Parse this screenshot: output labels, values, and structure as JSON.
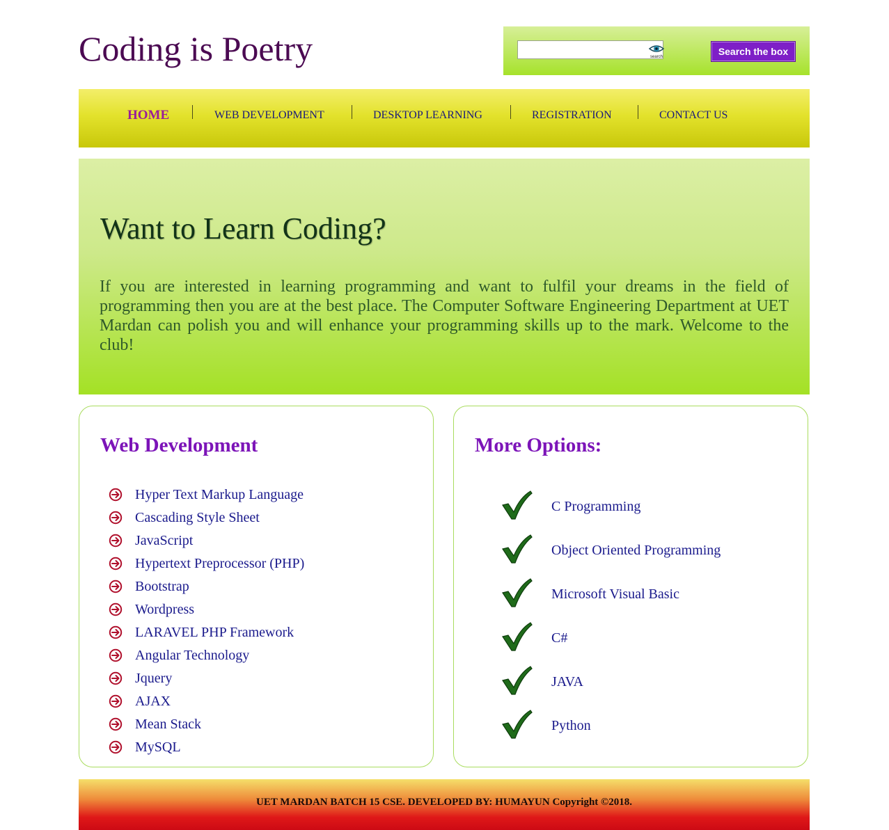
{
  "header": {
    "site_title": "Coding is Poetry",
    "search": {
      "placeholder": "",
      "icon_label": "search",
      "button_label": "Search the box"
    }
  },
  "nav": {
    "items": [
      {
        "label": "HOME",
        "active": true
      },
      {
        "label": "WEB DEVELOPMENT",
        "active": false
      },
      {
        "label": "DESKTOP LEARNING",
        "active": false
      },
      {
        "label": "REGISTRATION",
        "active": false
      },
      {
        "label": "CONTACT US",
        "active": false
      }
    ]
  },
  "hero": {
    "title": "Want to Learn Coding?",
    "text": "If you are interested in learning programming and want to fulfil your dreams in the field of programming then you are at the best place. The Computer Software Engineering Department at UET Mardan can polish you and will enhance your programming skills up to the mark. Welcome to the club!"
  },
  "web_panel": {
    "heading": "Web Development",
    "items": [
      "Hyper Text Markup Language",
      "Cascading Style Sheet",
      "JavaScript",
      "Hypertext Preprocessor (PHP)",
      "Bootstrap",
      "Wordpress",
      "LARAVEL PHP Framework",
      "Angular Technology",
      "Jquery",
      "AJAX",
      "Mean Stack",
      "MySQL"
    ],
    "bullet_icon": "circle-arrow-right-icon"
  },
  "more_panel": {
    "heading": "More Options:",
    "items": [
      "C Programming",
      "Object Oriented Programming",
      "Microsoft Visual Basic",
      "C#",
      "JAVA",
      "Python"
    ],
    "bullet_icon": "checkmark-icon"
  },
  "footer": {
    "text": "UET MARDAN BATCH 15 CSE. DEVELOPED BY: HUMAYUN Copyright ©2018."
  },
  "colors": {
    "title": "#4b0a52",
    "accent_purple": "#7c14b8",
    "nav_active": "#9a1c9a",
    "link_blue": "#1a1a8c",
    "check_green": "#1f6b1a",
    "arrow_red": "#b0102c"
  }
}
